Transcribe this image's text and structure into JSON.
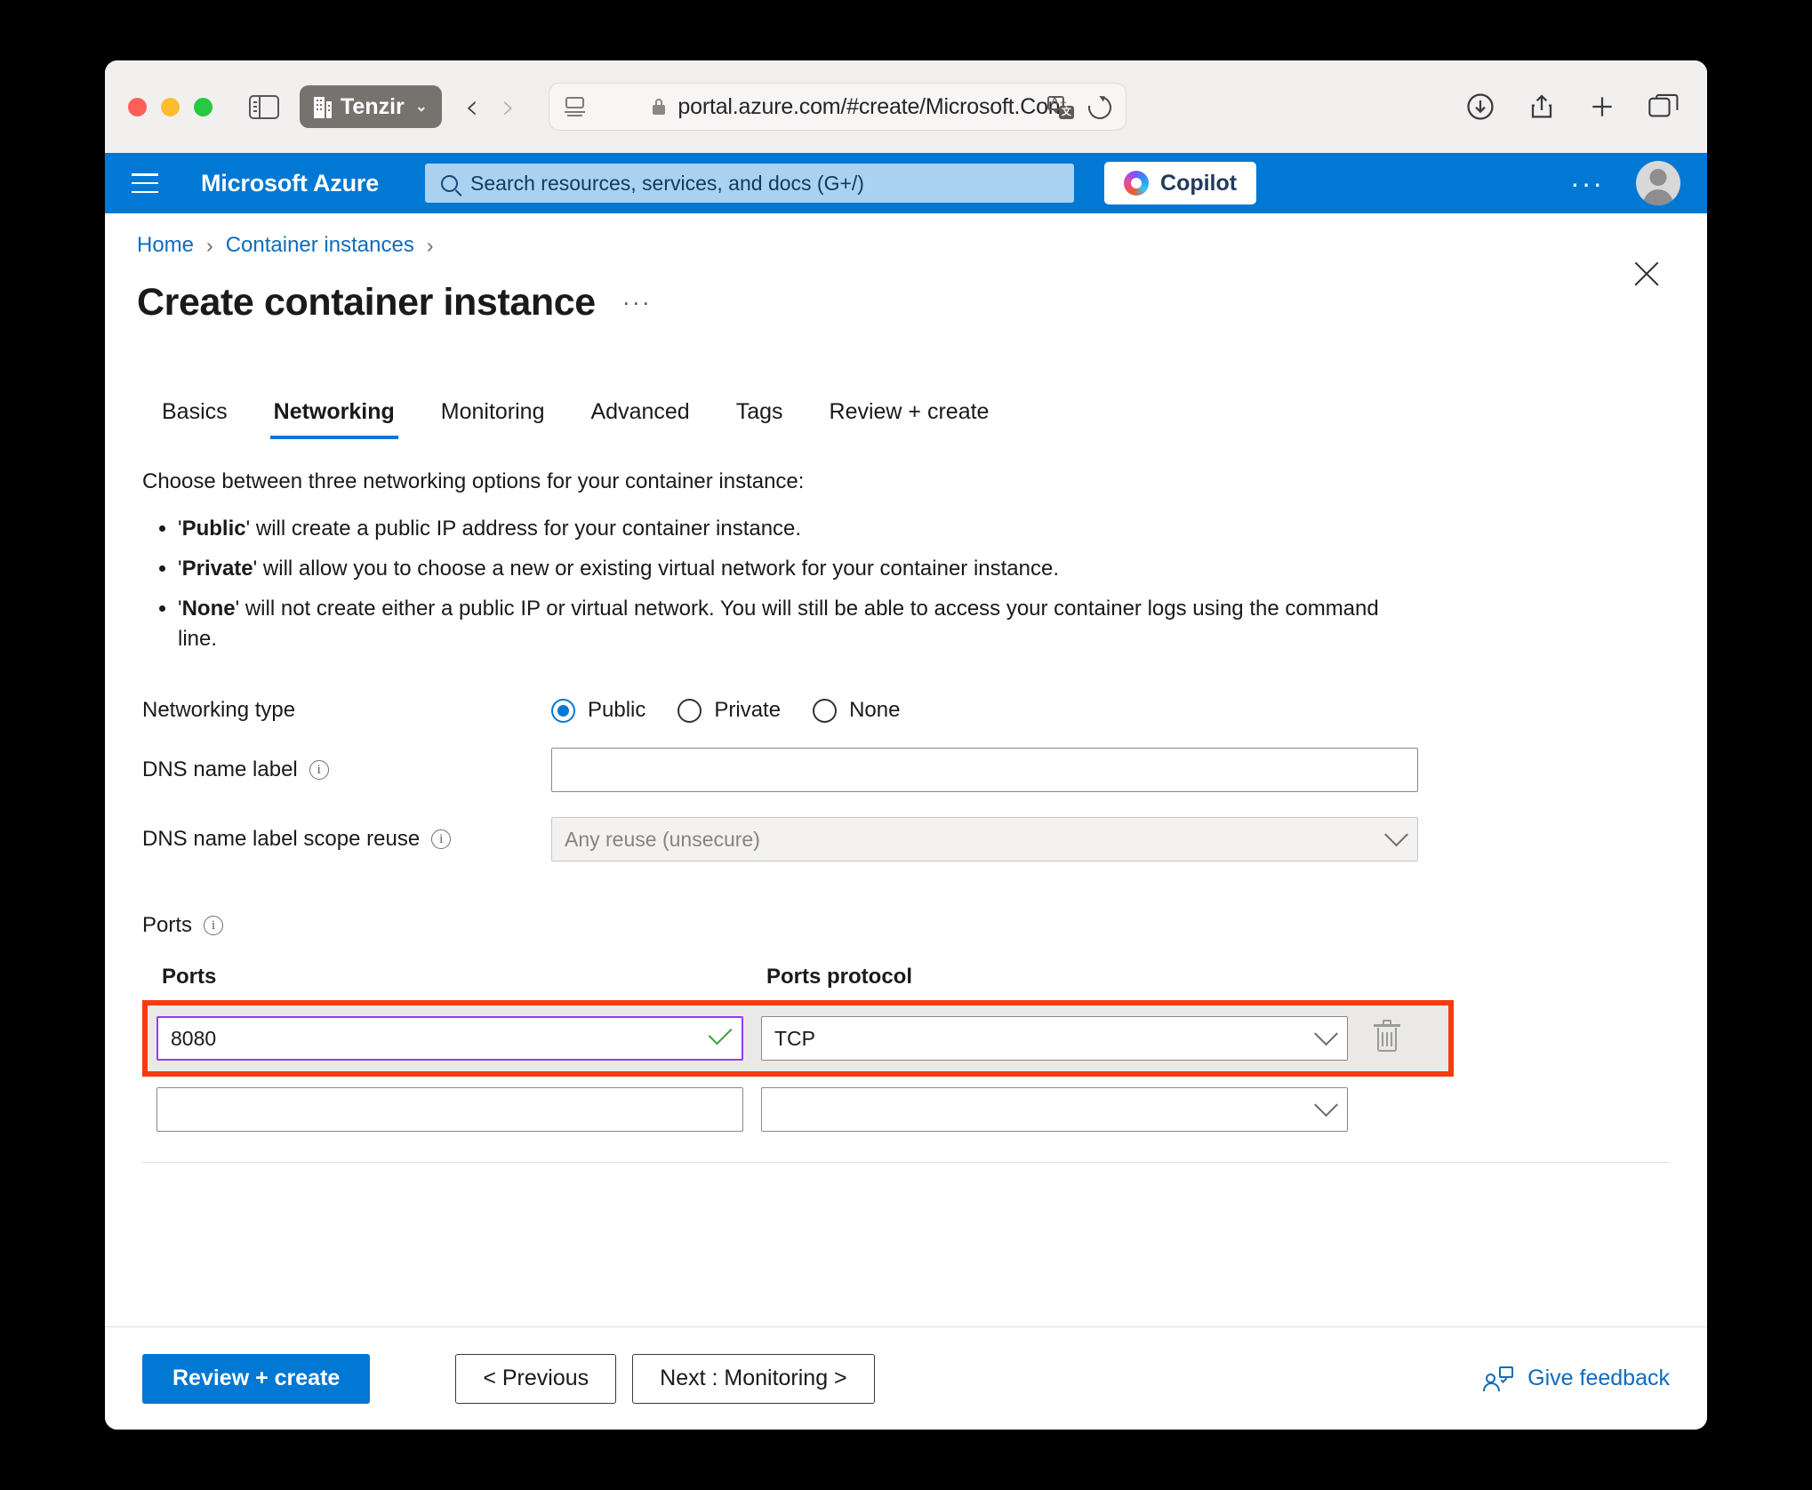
{
  "browser": {
    "profile_label": "Tenzir",
    "url": "portal.azure.com/#create/Microsoft.Con",
    "url_faded": "t",
    "icons": {
      "sidebar": "sidebar-toggle-icon",
      "back": "‹",
      "forward": "›",
      "download": "download-icon",
      "share": "share-icon",
      "newtab": "+",
      "tabs": "tab-overview-icon"
    }
  },
  "azure_header": {
    "brand": "Microsoft Azure",
    "search_placeholder": "Search resources, services, and docs (G+/)",
    "copilot_label": "Copilot",
    "more_label": "···"
  },
  "breadcrumb": {
    "items": [
      "Home",
      "Container instances"
    ],
    "separator": "›"
  },
  "page": {
    "title": "Create container instance",
    "title_more": "···"
  },
  "tabs": [
    {
      "label": "Basics",
      "active": false
    },
    {
      "label": "Networking",
      "active": true
    },
    {
      "label": "Monitoring",
      "active": false
    },
    {
      "label": "Advanced",
      "active": false
    },
    {
      "label": "Tags",
      "active": false
    },
    {
      "label": "Review + create",
      "active": false
    }
  ],
  "intro": {
    "heading": "Choose between three networking options for your container instance:",
    "bullets": [
      {
        "term": "Public",
        "text": "' will create a public IP address for your container instance.",
        "lead": "'"
      },
      {
        "term": "Private",
        "text": "' will allow you to choose a new or existing virtual network for your container instance.",
        "lead": "'"
      },
      {
        "term": "None",
        "text": "' will not create either a public IP or virtual network. You will still be able to access your container logs using the command line.",
        "lead": "'"
      }
    ]
  },
  "form": {
    "networking_type": {
      "label": "Networking type",
      "options": [
        "Public",
        "Private",
        "None"
      ],
      "selected": "Public"
    },
    "dns_name_label": {
      "label": "DNS name label",
      "value": "",
      "placeholder": ""
    },
    "dns_scope_reuse": {
      "label": "DNS name label scope reuse",
      "value": "Any reuse (unsecure)",
      "disabled": true
    }
  },
  "ports": {
    "section_label": "Ports",
    "columns": [
      "Ports",
      "Ports protocol"
    ],
    "rows": [
      {
        "port": "8080",
        "protocol": "TCP",
        "valid": true,
        "highlighted": true
      },
      {
        "port": "",
        "protocol": "",
        "valid": false,
        "highlighted": false
      }
    ],
    "delete_icon": "trash-icon",
    "highlight_color": "#f93a0e",
    "focus_border_color": "#8a3ffc",
    "valid_check_color": "#3aa13a"
  },
  "footer": {
    "review_create": "Review + create",
    "previous": "< Previous",
    "next": "Next : Monitoring >",
    "feedback": "Give feedback"
  },
  "colors": {
    "azure_blue": "#0078d4",
    "link_blue": "#0f6cbd",
    "search_bg": "#aad2f0"
  }
}
